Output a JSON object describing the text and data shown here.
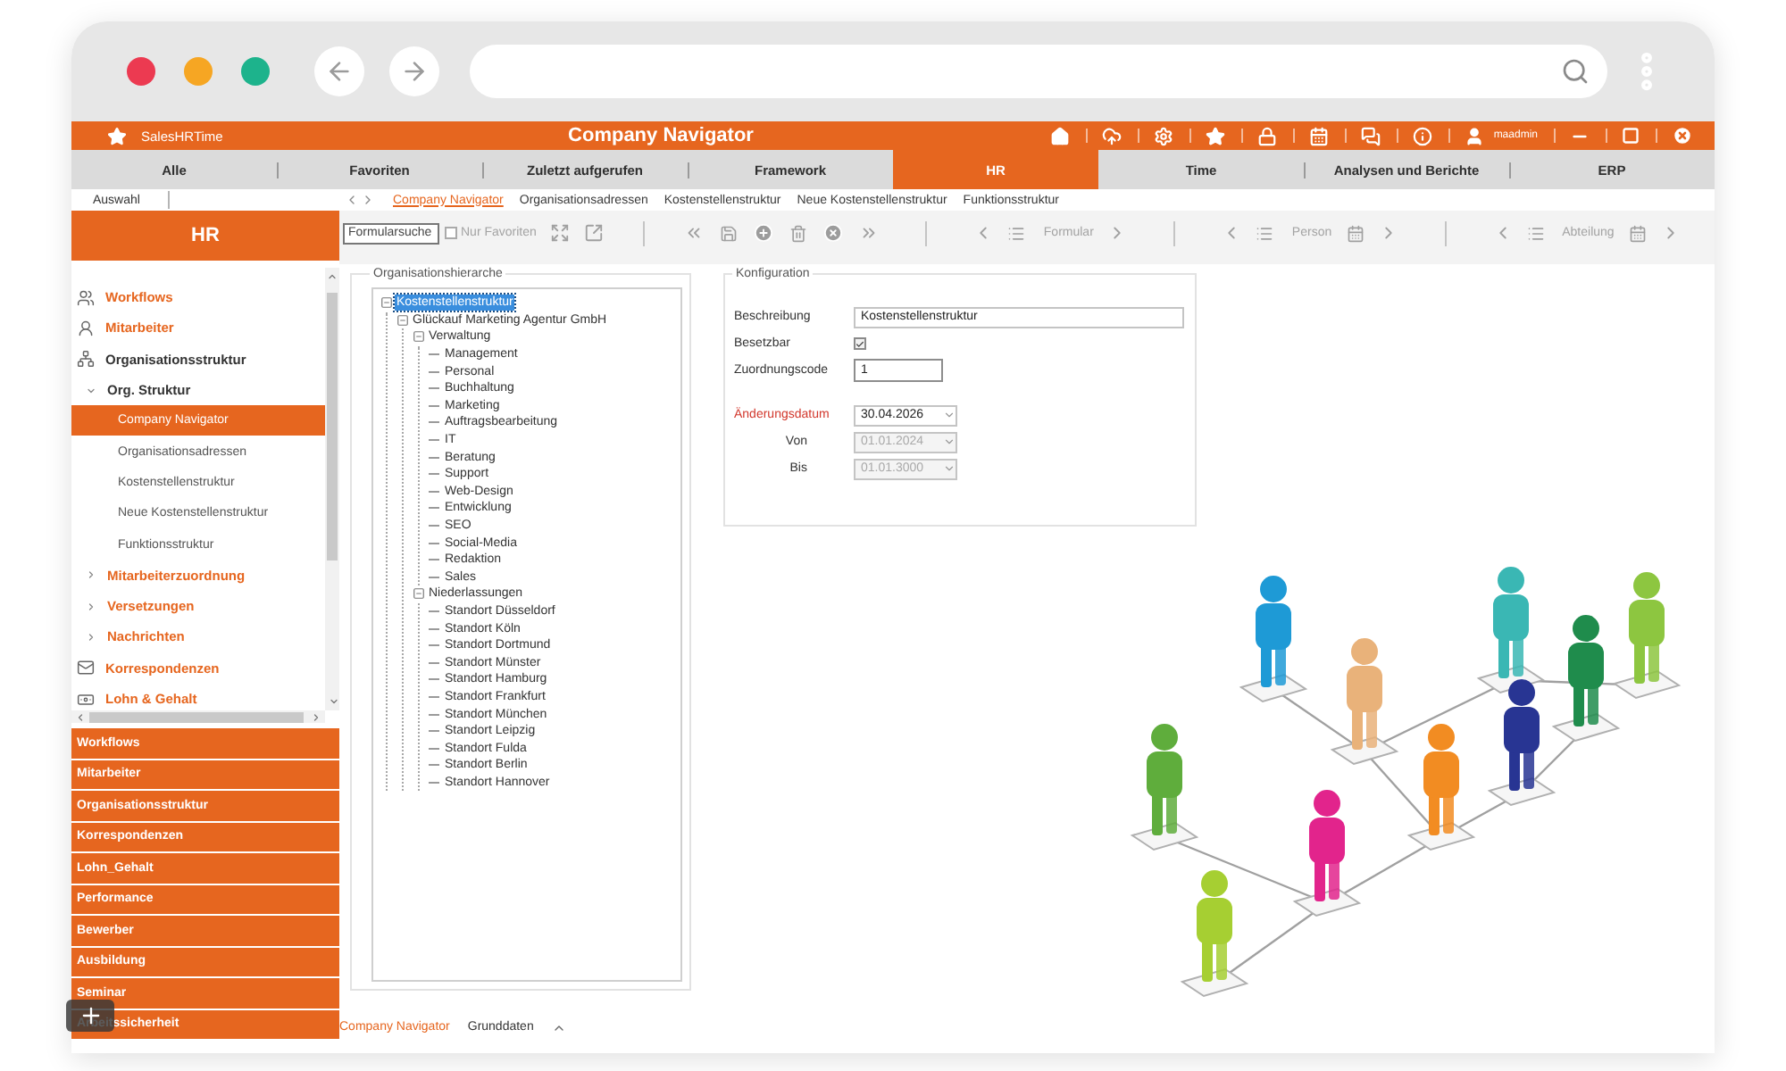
{
  "browser": {
    "dots": [
      {
        "color": "#ec3a51"
      },
      {
        "color": "#f6a623"
      },
      {
        "color": "#1db38c"
      }
    ]
  },
  "app_header": {
    "app_name": "SalesHRTime",
    "title": "Company Navigator",
    "user": "maadmin"
  },
  "tabs": [
    {
      "label": "Alle",
      "selected": false
    },
    {
      "label": "Favoriten",
      "selected": false
    },
    {
      "label": "Zuletzt aufgerufen",
      "selected": false
    },
    {
      "label": "Framework",
      "selected": false
    },
    {
      "label": "HR",
      "selected": true
    },
    {
      "label": "Time",
      "selected": false
    },
    {
      "label": "Analysen und Berichte",
      "selected": false
    },
    {
      "label": "ERP",
      "selected": false
    }
  ],
  "form_links": {
    "label": "Auswahl",
    "links": [
      {
        "label": "Company Navigator",
        "selected": true
      },
      {
        "label": "Organisationsadressen",
        "selected": false
      },
      {
        "label": "Kostenstellenstruktur",
        "selected": false
      },
      {
        "label": "Neue Kostenstellenstruktur",
        "selected": false
      },
      {
        "label": "Funktionsstruktur",
        "selected": false
      }
    ]
  },
  "sidebar": {
    "title": "HR",
    "tree": [
      {
        "label": "Workflows",
        "selected": false,
        "expanded": false
      },
      {
        "label": "Mitarbeiter",
        "selected": false,
        "expanded": false
      },
      {
        "label": "Organisationsstruktur",
        "selected": false,
        "expanded": true,
        "children": [
          {
            "label": "Org. Struktur",
            "selected": false,
            "expanded": true,
            "children": [
              {
                "label": "Company Navigator",
                "selected": true
              },
              {
                "label": "Organisationsadressen",
                "selected": false
              },
              {
                "label": "Kostenstellenstruktur",
                "selected": false
              },
              {
                "label": "Neue Kostenstellenstruktur",
                "selected": false
              },
              {
                "label": "Funktionsstruktur",
                "selected": false
              }
            ]
          },
          {
            "label": "Mitarbeiterzuordnung",
            "selected": false,
            "expanded": false
          },
          {
            "label": "Versetzungen",
            "selected": false,
            "expanded": false
          },
          {
            "label": "Nachrichten",
            "selected": false,
            "expanded": false
          }
        ]
      },
      {
        "label": "Korrespondenzen",
        "selected": false,
        "expanded": false
      },
      {
        "label": "Lohn & Gehalt",
        "selected": false,
        "expanded": false
      }
    ],
    "sections": [
      "Workflows",
      "Mitarbeiter",
      "Organisationsstruktur",
      "Korrespondenzen",
      "Lohn_Gehalt",
      "Performance",
      "Bewerber",
      "Ausbildung",
      "Seminar",
      "Arbeitssicherheit"
    ]
  },
  "toolbar": {
    "search": {
      "placeholder": "Formularsuche"
    },
    "favorites_only": {
      "label": "Nur Favoriten",
      "checked": false
    },
    "navigators": [
      {
        "label": "Formular",
        "kind": "plain"
      },
      {
        "label": "Person",
        "kind": "dated"
      },
      {
        "label": "Abteilung",
        "kind": "dated"
      }
    ]
  },
  "hierarchy": {
    "title": "Organisationshierarche",
    "tree": [
      {
        "label": "Kostenstellenstruktur",
        "selected": true,
        "expanded": true,
        "children": [
          {
            "label": "Glückauf Marketing Agentur GmbH",
            "selected": false,
            "expanded": true,
            "children": [
              {
                "label": "Verwaltung",
                "selected": false,
                "expanded": true,
                "children": [
                  {
                    "label": "Management",
                    "selected": false
                  },
                  {
                    "label": "Personal",
                    "selected": false
                  },
                  {
                    "label": "Buchhaltung",
                    "selected": false
                  },
                  {
                    "label": "Marketing",
                    "selected": false
                  },
                  {
                    "label": "Auftragsbearbeitung",
                    "selected": false
                  },
                  {
                    "label": "IT",
                    "selected": false
                  },
                  {
                    "label": "Beratung",
                    "selected": false
                  },
                  {
                    "label": "Support",
                    "selected": false
                  },
                  {
                    "label": "Web-Design",
                    "selected": false
                  },
                  {
                    "label": "Entwicklung",
                    "selected": false
                  },
                  {
                    "label": "SEO",
                    "selected": false
                  },
                  {
                    "label": "Social-Media",
                    "selected": false
                  },
                  {
                    "label": "Redaktion",
                    "selected": false
                  },
                  {
                    "label": "Sales",
                    "selected": false
                  }
                ]
              },
              {
                "label": "Niederlassungen",
                "selected": false,
                "expanded": true,
                "children": [
                  {
                    "label": "Standort Düsseldorf",
                    "selected": false
                  },
                  {
                    "label": "Standort Köln",
                    "selected": false
                  },
                  {
                    "label": "Standort Dortmund",
                    "selected": false
                  },
                  {
                    "label": "Standort Münster",
                    "selected": false
                  },
                  {
                    "label": "Standort Hamburg",
                    "selected": false
                  },
                  {
                    "label": "Standort Frankfurt",
                    "selected": false
                  },
                  {
                    "label": "Standort München",
                    "selected": false
                  },
                  {
                    "label": "Standort Leipzig",
                    "selected": false
                  },
                  {
                    "label": "Standort Fulda",
                    "selected": false
                  },
                  {
                    "label": "Standort Berlin",
                    "selected": false
                  },
                  {
                    "label": "Standort Hannover",
                    "selected": false
                  }
                ]
              }
            ]
          }
        ]
      }
    ]
  },
  "configuration": {
    "title": "Konfiguration",
    "fields": [
      {
        "label": "Beschreibung",
        "kind": "text",
        "value": "Kostenstellenstruktur"
      },
      {
        "label": "Besetzbar",
        "kind": "checkbox",
        "checked": true
      },
      {
        "label": "Zuordnungscode",
        "kind": "code",
        "value": "1"
      },
      {
        "label": "Änderungsdatum",
        "kind": "date",
        "value": "30.04.2026",
        "highlighted": true,
        "disabled": false
      },
      {
        "label": "Von",
        "kind": "bound",
        "value": "01.01.2024",
        "highlighted": false,
        "disabled": true
      },
      {
        "label": "Bis",
        "kind": "bound",
        "value": "01.01.3000",
        "highlighted": false,
        "disabled": true
      }
    ]
  },
  "view_tabs": [
    {
      "label": "Company Navigator",
      "selected": true
    },
    {
      "label": "Grunddaten",
      "selected": false
    }
  ]
}
